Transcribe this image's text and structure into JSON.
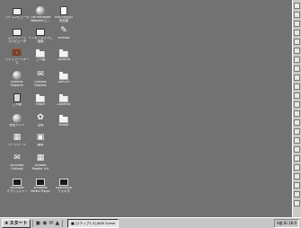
{
  "desktop": {
    "background_color": "#727272",
    "icons": [
      {
        "label": "マイコンピュータ",
        "icon": "my-computer-icon"
      },
      {
        "label": "The Microsoft\nNetwork に...",
        "icon": "msn-icon"
      },
      {
        "label": "PDFの作成の\n完全版",
        "icon": "pdf-document-icon"
      },
      {
        "label": "ネットワーク\nコンピュータ",
        "icon": "network-computer-icon"
      },
      {
        "label": "インターネットに\n接続",
        "icon": "connect-internet-icon"
      },
      {
        "label": "Wnmap",
        "icon": "wnmap-icon"
      },
      {
        "label": "マイブリーフケース",
        "icon": "briefcase-icon"
      },
      {
        "label": "ゴミ箱",
        "icon": "shortcut-folder-icon"
      },
      {
        "label": "ZoneLIB",
        "icon": "folder-icon"
      },
      {
        "label": "Internet\nExplorer",
        "icon": "internet-explorer-icon"
      },
      {
        "label": "Outlook\nExpress",
        "icon": "outlook-express-icon"
      },
      {
        "label": "ZonCVU",
        "icon": "folder-icon"
      },
      {
        "label": "ごみ箱",
        "icon": "recycle-bin-icon"
      },
      {
        "label": "Enjoin",
        "icon": "folder-icon"
      },
      {
        "label": "ZoneRMI",
        "icon": "folder-icon"
      },
      {
        "label": "受信トレイ",
        "icon": "inbox-icon"
      },
      {
        "label": "沼地",
        "icon": "application-icon"
      },
      {
        "label": "Bridge",
        "icon": "folder-icon"
      },
      {
        "label": "ワークシート",
        "icon": "worksheet-icon"
      },
      {
        "label": "画像",
        "icon": "image-viewer-icon"
      },
      {
        "label": "Microsoft\nOutlook",
        "icon": "microsoft-outlook-icon"
      },
      {
        "label": "Acrobat\nReader 4.0",
        "icon": "acrobat-reader-icon"
      },
      {
        "label": "Microsoft\nパブリッシャー",
        "icon": "microsoft-publisher-icon"
      },
      {
        "label": "Windows\nMedia Player",
        "icon": "windows-media-player-icon"
      },
      {
        "label": "Shareware\nフォルダ",
        "icon": "shareware-icon"
      }
    ]
  },
  "taskbar": {
    "start_label": "スタート",
    "task_label": "[ステップ1-3] JADE Scene",
    "tray_text": "A般 Bi 18:0"
  }
}
